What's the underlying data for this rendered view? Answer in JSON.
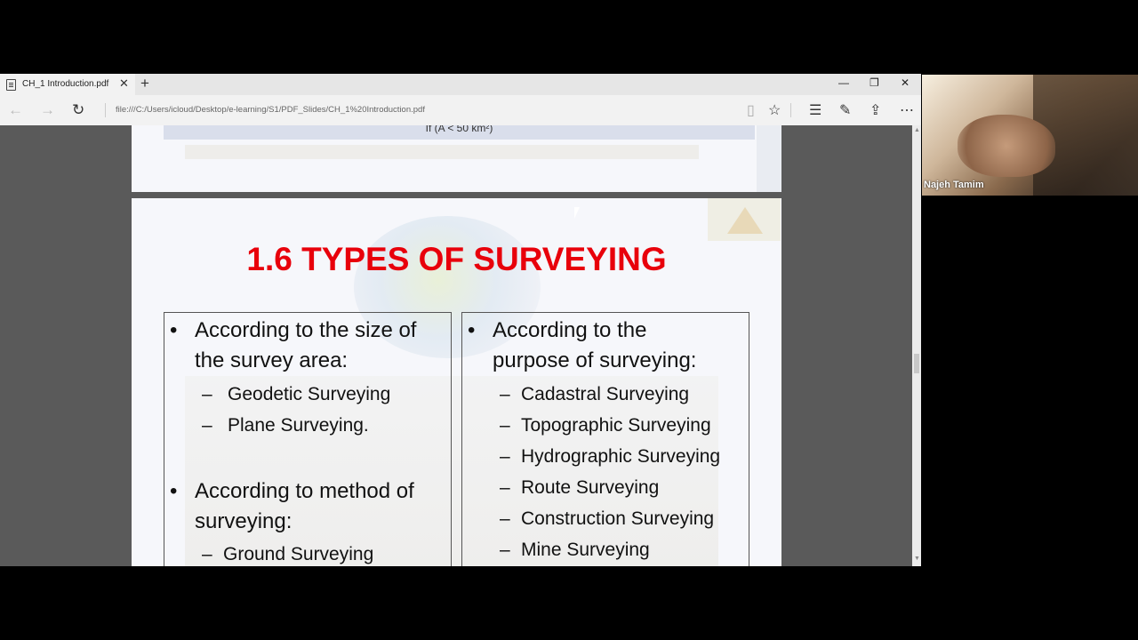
{
  "browser": {
    "tab_title": "CH_1 Introduction.pdf",
    "tab_close": "✕",
    "new_tab": "+",
    "win_min": "—",
    "win_restore": "❐",
    "win_close": "✕",
    "url": "file:///C:/Users/icloud/Desktop/e-learning/S1/PDF_Slides/CH_1%20Introduction.pdf",
    "icons": [
      "back-icon",
      "forward-icon",
      "refresh-icon",
      "reading-view-icon",
      "favorite-star-icon",
      "hub-icon",
      "web-note-icon",
      "share-icon",
      "more-icon"
    ]
  },
  "page1": {
    "band_text": "If (A < 50 km²)"
  },
  "slide": {
    "title": "1.6  TYPES OF SURVEYING",
    "left": {
      "item1": "According to the size of",
      "item1b": "the survey area:",
      "item1_sub": [
        "Geodetic Surveying",
        "Plane Surveying."
      ],
      "item2": "According to method of",
      "item2b": "surveying:",
      "item2_sub": [
        "Ground Surveying"
      ]
    },
    "right": {
      "item1": "According to the",
      "item1b": "purpose of surveying:",
      "item1_sub": [
        "Cadastral Surveying",
        "Topographic Surveying",
        "Hydrographic Surveying",
        "Route Surveying",
        "Construction Surveying",
        "Mine Surveying"
      ]
    },
    "bullet": "•",
    "dash": "–"
  },
  "webcam": {
    "participant_name": "Najeh Tamim"
  }
}
